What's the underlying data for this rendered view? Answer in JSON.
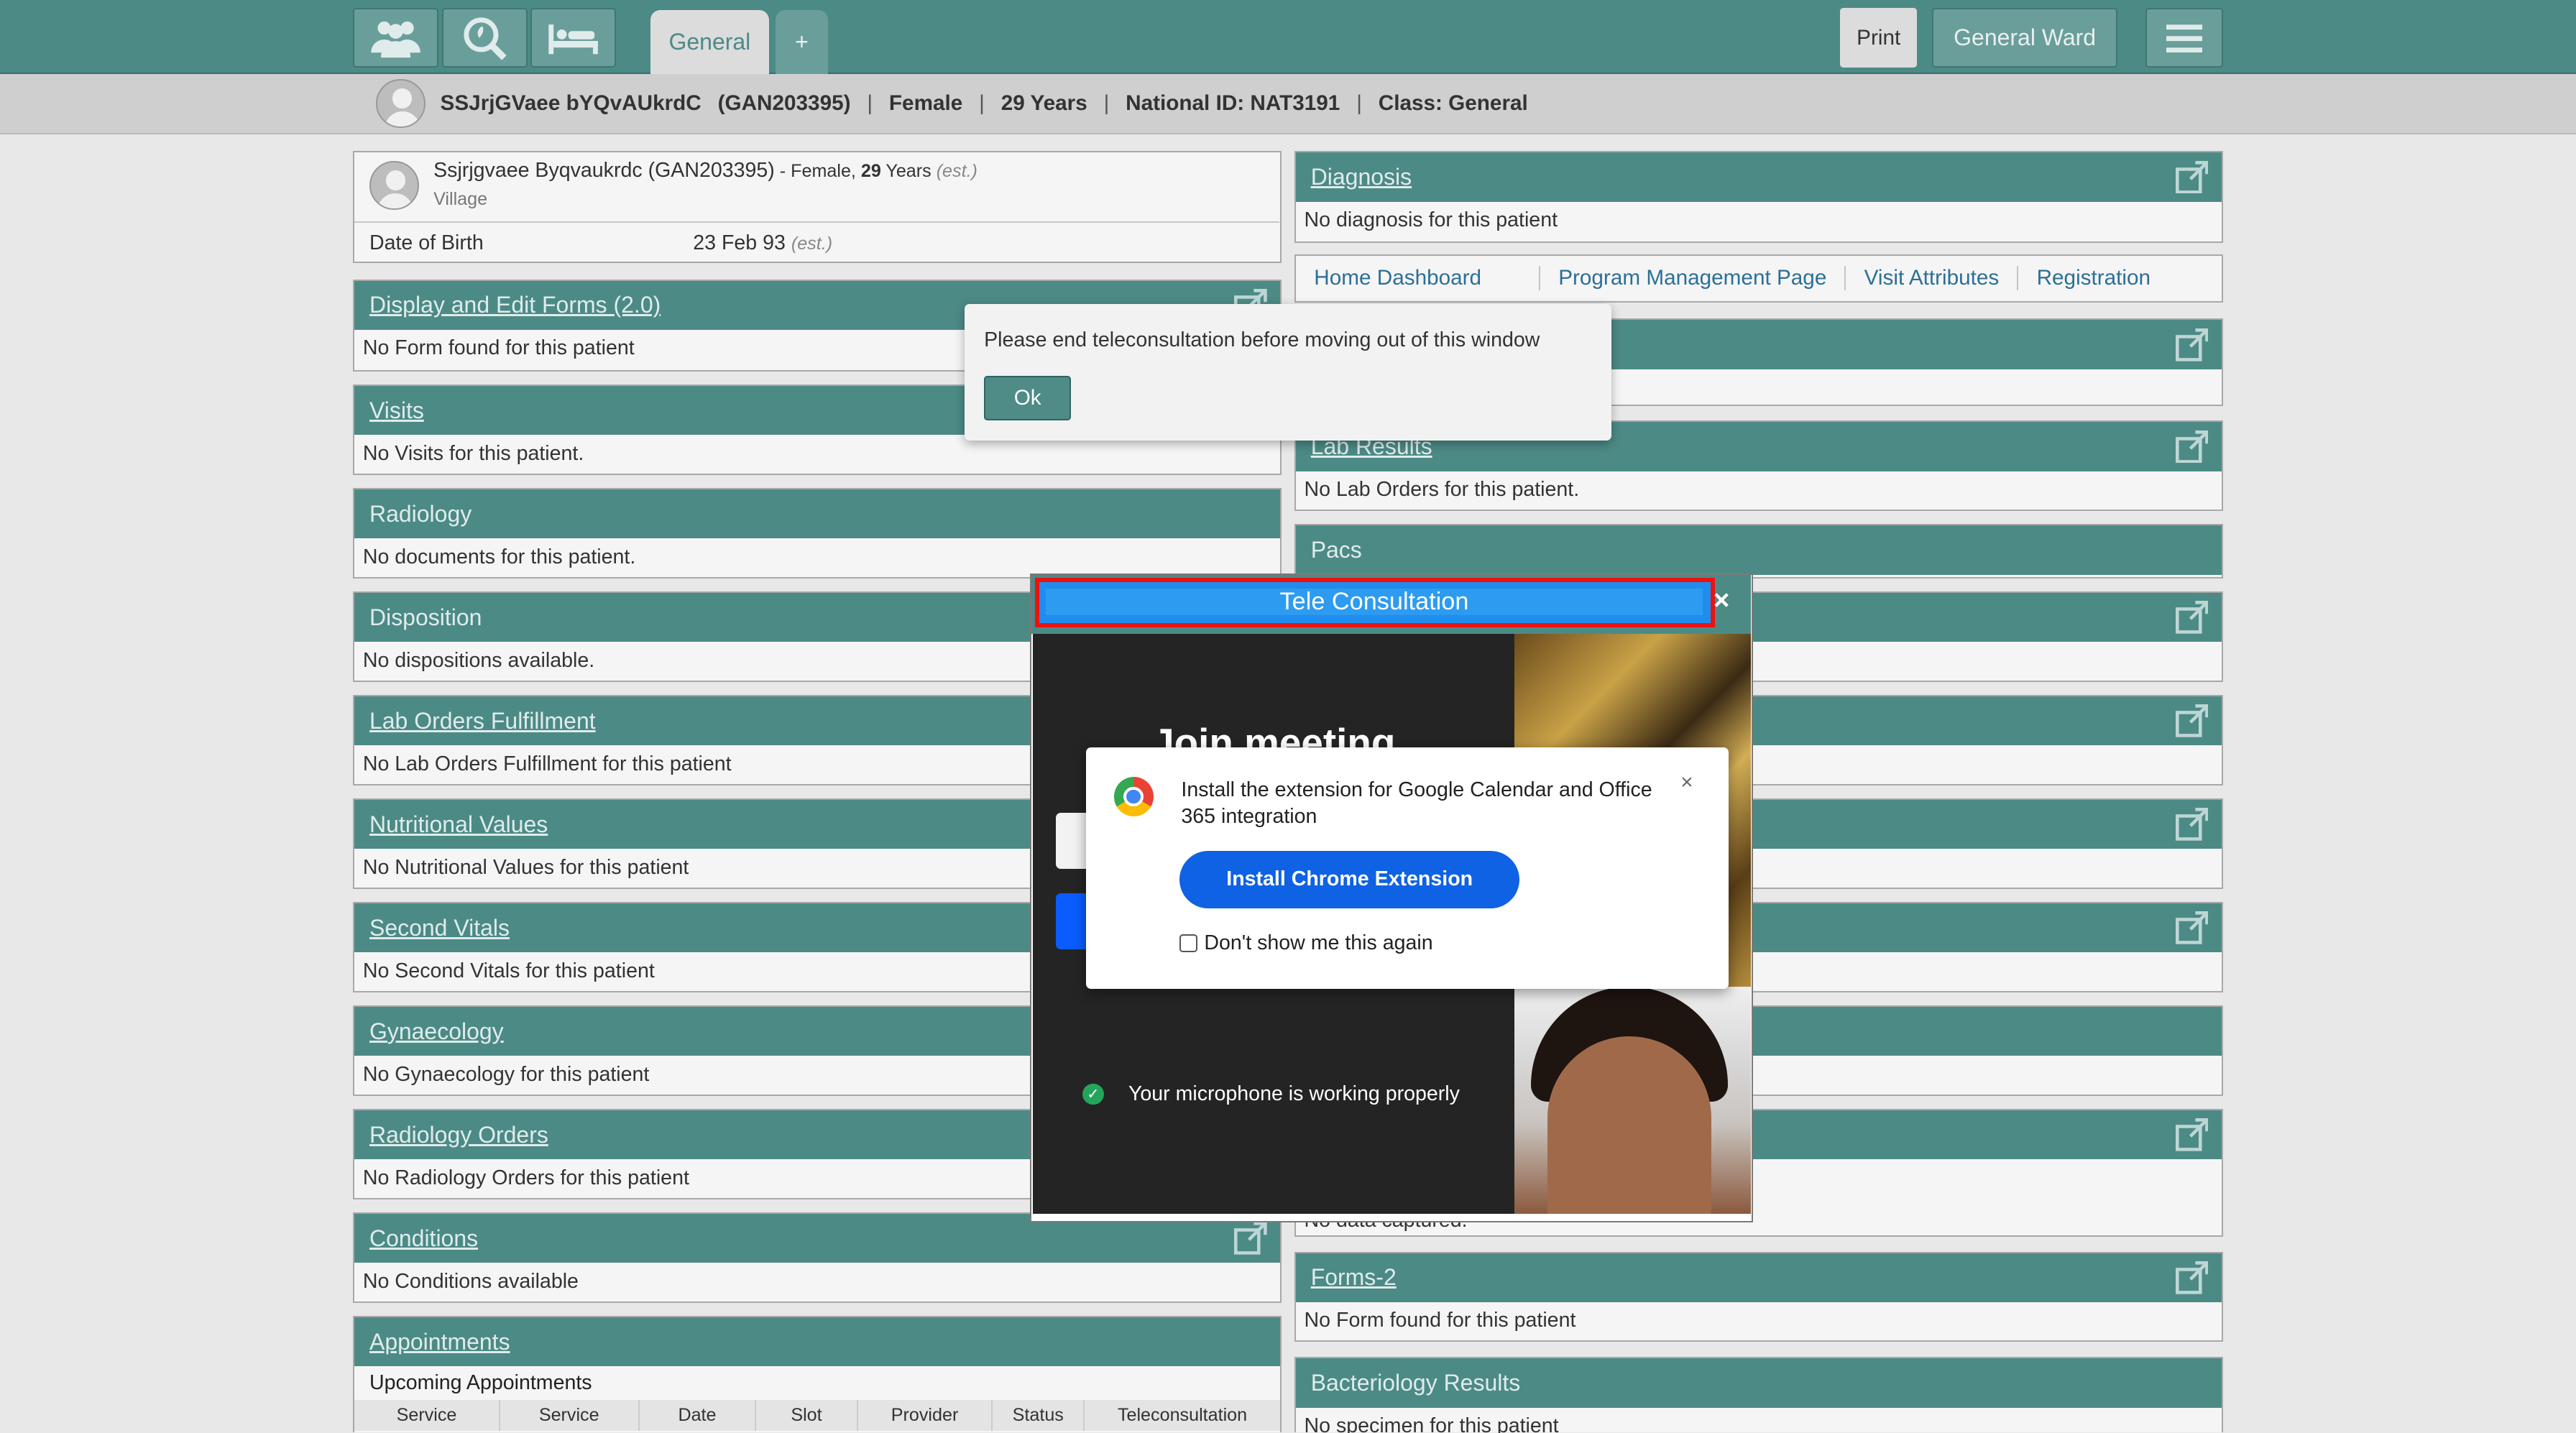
{
  "header": {
    "tabs": [
      {
        "label": "General"
      },
      {
        "label": "+"
      }
    ],
    "print_label": "Print",
    "ward_label": "General Ward"
  },
  "patient_bar": {
    "name": "SSJrjGVaee bYQvAUkrdC",
    "id": "(GAN203395)",
    "gender": "Female",
    "age": "29 Years",
    "national_id": "National ID: NAT3191",
    "class": "Class: General"
  },
  "patient_card": {
    "name": "Ssjrjgvaee Byqvaukrdc (GAN203395)",
    "gender_prefix": " - Female, ",
    "age": "29",
    "age_suffix": " Years ",
    "est": "(est.)",
    "village": "Village",
    "dob_label": "Date of Birth",
    "dob_value": "23 Feb 93",
    "dob_est": "(est.)"
  },
  "left_panels": [
    {
      "title": "Display and Edit Forms (2.0)",
      "body": "No Form found for this patient"
    },
    {
      "title": "Visits",
      "body": "No Visits for this patient."
    },
    {
      "title": "Radiology",
      "body": "No documents for this patient."
    },
    {
      "title": "Disposition",
      "body": "No dispositions available."
    },
    {
      "title": "Lab Orders Fulfillment",
      "body": "No Lab Orders Fulfillment for this patient"
    },
    {
      "title": "Nutritional Values",
      "body": "No Nutritional Values for this patient"
    },
    {
      "title": "Second Vitals",
      "body": "No Second Vitals for this patient"
    },
    {
      "title": "Gynaecology",
      "body": "No Gynaecology for this patient"
    },
    {
      "title": "Radiology Orders",
      "body": "No Radiology Orders for this patient"
    },
    {
      "title": "Conditions",
      "body": "No Conditions available"
    },
    {
      "title": "Appointments",
      "body": "Upcoming Appointments"
    }
  ],
  "appointments_columns": [
    "Service",
    "Service",
    "Date",
    "Slot",
    "Provider",
    "Status",
    "Teleconsultation"
  ],
  "right_panels": {
    "diagnosis": {
      "title": "Diagnosis",
      "body": "No diagnosis for this patient"
    },
    "lab_results": {
      "title": "Lab Results",
      "body": "No Lab Orders for this patient."
    },
    "pacs": {
      "title": "Pacs"
    },
    "forms2": {
      "title": "Forms-2",
      "body": "No Form found for this patient"
    },
    "bacteriology": {
      "title": "Bacteriology Results",
      "body": "No specimen for this patient"
    },
    "partial_body": "No data captured."
  },
  "links": [
    "Home Dashboard",
    "Program Management Page",
    "Visit Attributes",
    "Registration"
  ],
  "alert": {
    "message": "Please end teleconsultation before moving out of this window",
    "ok_label": "Ok"
  },
  "tele": {
    "title": "Tele Consultation",
    "close": "×",
    "join_heading": "Join meeting",
    "mic_status": "Your microphone is working properly"
  },
  "extension_popup": {
    "text": "Install the extension for Google Calendar and Office 365 integration",
    "close": "×",
    "install_label": "Install Chrome Extension",
    "dont_show_label": "Don't show me this again"
  },
  "icons": [
    "patients-icon",
    "search-icon",
    "bed-icon",
    "menu-icon",
    "external-link-icon",
    "chrome-icon",
    "check-icon",
    "avatar-icon"
  ],
  "colors": {
    "header": "#4c8a86",
    "link": "#2c6f96",
    "install_button": "#0e62e3",
    "tele_title": "#2d9bf0",
    "highlight_border": "#ee1111"
  }
}
